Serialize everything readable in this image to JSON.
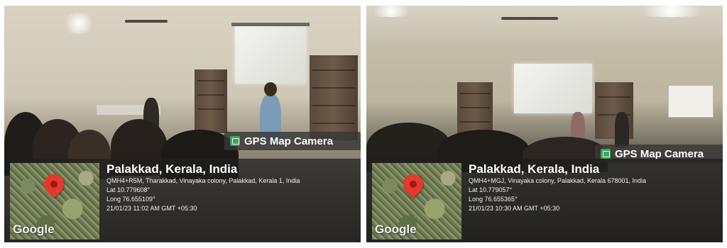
{
  "photos": [
    {
      "badge": "GPS Map Camera",
      "google": "Google",
      "place": "Palakkad, Kerala, India",
      "address": "QMH4+R5M, Tharakkad, Vinayaka colony, Palakkad, Kerala 1, India",
      "lat": "Lat 10.779608°",
      "long": "Long 76.655109°",
      "datetime": "21/01/23 11:02 AM GMT +05:30"
    },
    {
      "badge": "GPS Map Camera",
      "google": "Google",
      "place": "Palakkad, Kerala, India",
      "address": "QMH4+MGJ, Vinayaka colony, Palakkad, Kerala 678001, India",
      "lat": "Lat 10.779057°",
      "long": "Long 76.655365°",
      "datetime": "21/01/23 10:30 AM GMT +05:30"
    }
  ],
  "colors": {
    "pin": "#e5392d",
    "badge_icon": "#3da55b",
    "overlay": "#1e1e1e"
  }
}
